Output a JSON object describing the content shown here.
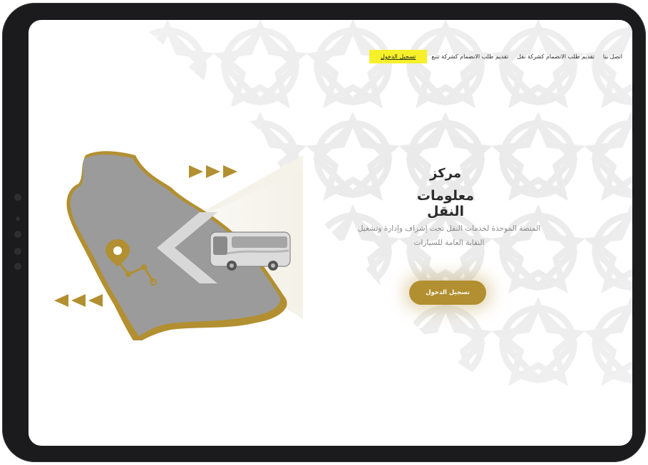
{
  "nav": {
    "items": [
      {
        "label": "اتصل بنا"
      },
      {
        "label": "تقديم طلب الانضمام كشركة نقل"
      },
      {
        "label": "تقديم طلب الانضمام كشركة تتبع"
      },
      {
        "label": "تسجيل الدخول",
        "active": true
      }
    ]
  },
  "hero": {
    "title_line1": "مركز",
    "title_line2": "معلومات النقل",
    "subtitle_line1": "المنصة الموحدة لخدمات النقل تحت إشراف وإدارة وتشغيل",
    "subtitle_line2": "النقابة العامة للسيارات",
    "cta_label": "تسجيل الدخول"
  },
  "colors": {
    "accent_gold": "#b28f30",
    "highlight_yellow": "#f6f02a",
    "map_gray": "#9b9b9b",
    "text_dark": "#2b2b2b"
  },
  "icons": [
    "location-pin-icon",
    "bus-icon",
    "arrow-right-icon",
    "arrow-left-icon"
  ]
}
